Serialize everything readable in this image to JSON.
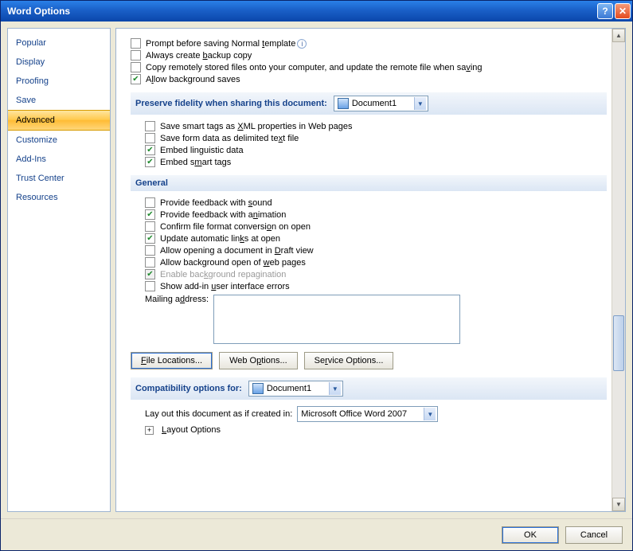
{
  "window": {
    "title": "Word Options"
  },
  "sidebar": {
    "items": [
      {
        "label": "Popular"
      },
      {
        "label": "Display"
      },
      {
        "label": "Proofing"
      },
      {
        "label": "Save"
      },
      {
        "label": "Advanced",
        "selected": true
      },
      {
        "label": "Customize"
      },
      {
        "label": "Add-Ins"
      },
      {
        "label": "Trust Center"
      },
      {
        "label": "Resources"
      }
    ]
  },
  "top_checks": [
    {
      "label_pre": "Prompt before saving Normal ",
      "u": "t",
      "label_post": "emplate",
      "checked": false,
      "info": true
    },
    {
      "label_pre": "Always create ",
      "u": "b",
      "label_post": "ackup copy",
      "checked": false
    },
    {
      "label_pre": "Copy remotely stored files onto your computer, and update the remote file when sa",
      "u": "v",
      "label_post": "ing",
      "checked": false
    },
    {
      "label_pre": "A",
      "u": "l",
      "label_post": "low background saves",
      "checked": true
    }
  ],
  "preserve": {
    "header": "Preserve fidelity when sharing this document:",
    "combo_value": "Document1",
    "items": [
      {
        "label_pre": "Save smart tags as ",
        "u": "X",
        "label_post": "ML properties in Web pages",
        "checked": false
      },
      {
        "label_pre": "Save form data as delimited te",
        "u": "x",
        "label_post": "t file",
        "checked": false
      },
      {
        "label_pre": "Embed lin",
        "u": "g",
        "label_post": "uistic data",
        "checked": true
      },
      {
        "label_pre": "Embed s",
        "u": "m",
        "label_post": "art tags",
        "checked": true
      }
    ]
  },
  "general": {
    "header": "General",
    "items": [
      {
        "label_pre": "Provide feedback with ",
        "u": "s",
        "label_post": "ound",
        "checked": false
      },
      {
        "label_pre": "Provide feedback with a",
        "u": "n",
        "label_post": "imation",
        "checked": true
      },
      {
        "label_pre": "Confirm file format conversi",
        "u": "o",
        "label_post": "n on open",
        "checked": false
      },
      {
        "label_pre": "Update automatic lin",
        "u": "k",
        "label_post": "s at open",
        "checked": true
      },
      {
        "label_pre": "Allow opening a document in ",
        "u": "D",
        "label_post": "raft view",
        "checked": false
      },
      {
        "label_pre": "Allow background open of ",
        "u": "w",
        "label_post": "eb pages",
        "checked": false
      },
      {
        "label_pre": "Enable bac",
        "u": "k",
        "label_post": "ground repagination",
        "checked": true,
        "disabled": true
      },
      {
        "label_pre": "Show add-in ",
        "u": "u",
        "label_post": "ser interface errors",
        "checked": false
      }
    ],
    "mailing_label_pre": "Mailing a",
    "mailing_u": "d",
    "mailing_label_post": "dress:",
    "mailing_value": "",
    "buttons": {
      "file_locations_pre": "",
      "file_locations_u": "F",
      "file_locations_post": "ile Locations...",
      "web_options_pre": "Web O",
      "web_options_u": "p",
      "web_options_post": "tions...",
      "service_options_pre": "Se",
      "service_options_u": "r",
      "service_options_post": "vice Options..."
    }
  },
  "compat": {
    "header": "Compatibility options for:",
    "combo_value": "Document1",
    "layout_as_label": "Lay out this document as if created in:",
    "layout_combo_value": "Microsoft Office Word 2007",
    "layout_options_pre": "",
    "layout_options_u": "L",
    "layout_options_post": "ayout Options"
  },
  "footer": {
    "ok": "OK",
    "cancel": "Cancel"
  }
}
